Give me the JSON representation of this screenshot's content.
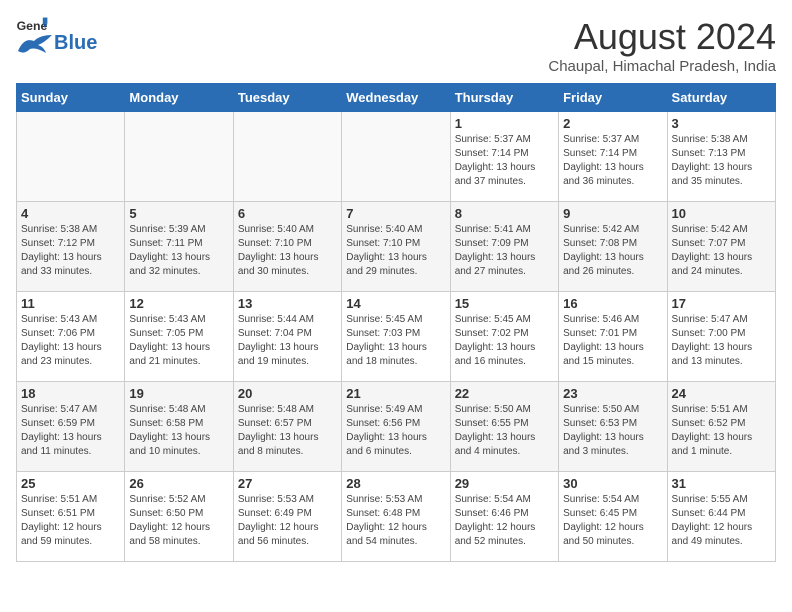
{
  "header": {
    "logo_general": "General",
    "logo_blue": "Blue",
    "title": "August 2024",
    "location": "Chaupal, Himachal Pradesh, India"
  },
  "days_of_week": [
    "Sunday",
    "Monday",
    "Tuesday",
    "Wednesday",
    "Thursday",
    "Friday",
    "Saturday"
  ],
  "weeks": [
    [
      {
        "day": "",
        "info": ""
      },
      {
        "day": "",
        "info": ""
      },
      {
        "day": "",
        "info": ""
      },
      {
        "day": "",
        "info": ""
      },
      {
        "day": "1",
        "info": "Sunrise: 5:37 AM\nSunset: 7:14 PM\nDaylight: 13 hours\nand 37 minutes."
      },
      {
        "day": "2",
        "info": "Sunrise: 5:37 AM\nSunset: 7:14 PM\nDaylight: 13 hours\nand 36 minutes."
      },
      {
        "day": "3",
        "info": "Sunrise: 5:38 AM\nSunset: 7:13 PM\nDaylight: 13 hours\nand 35 minutes."
      }
    ],
    [
      {
        "day": "4",
        "info": "Sunrise: 5:38 AM\nSunset: 7:12 PM\nDaylight: 13 hours\nand 33 minutes."
      },
      {
        "day": "5",
        "info": "Sunrise: 5:39 AM\nSunset: 7:11 PM\nDaylight: 13 hours\nand 32 minutes."
      },
      {
        "day": "6",
        "info": "Sunrise: 5:40 AM\nSunset: 7:10 PM\nDaylight: 13 hours\nand 30 minutes."
      },
      {
        "day": "7",
        "info": "Sunrise: 5:40 AM\nSunset: 7:10 PM\nDaylight: 13 hours\nand 29 minutes."
      },
      {
        "day": "8",
        "info": "Sunrise: 5:41 AM\nSunset: 7:09 PM\nDaylight: 13 hours\nand 27 minutes."
      },
      {
        "day": "9",
        "info": "Sunrise: 5:42 AM\nSunset: 7:08 PM\nDaylight: 13 hours\nand 26 minutes."
      },
      {
        "day": "10",
        "info": "Sunrise: 5:42 AM\nSunset: 7:07 PM\nDaylight: 13 hours\nand 24 minutes."
      }
    ],
    [
      {
        "day": "11",
        "info": "Sunrise: 5:43 AM\nSunset: 7:06 PM\nDaylight: 13 hours\nand 23 minutes."
      },
      {
        "day": "12",
        "info": "Sunrise: 5:43 AM\nSunset: 7:05 PM\nDaylight: 13 hours\nand 21 minutes."
      },
      {
        "day": "13",
        "info": "Sunrise: 5:44 AM\nSunset: 7:04 PM\nDaylight: 13 hours\nand 19 minutes."
      },
      {
        "day": "14",
        "info": "Sunrise: 5:45 AM\nSunset: 7:03 PM\nDaylight: 13 hours\nand 18 minutes."
      },
      {
        "day": "15",
        "info": "Sunrise: 5:45 AM\nSunset: 7:02 PM\nDaylight: 13 hours\nand 16 minutes."
      },
      {
        "day": "16",
        "info": "Sunrise: 5:46 AM\nSunset: 7:01 PM\nDaylight: 13 hours\nand 15 minutes."
      },
      {
        "day": "17",
        "info": "Sunrise: 5:47 AM\nSunset: 7:00 PM\nDaylight: 13 hours\nand 13 minutes."
      }
    ],
    [
      {
        "day": "18",
        "info": "Sunrise: 5:47 AM\nSunset: 6:59 PM\nDaylight: 13 hours\nand 11 minutes."
      },
      {
        "day": "19",
        "info": "Sunrise: 5:48 AM\nSunset: 6:58 PM\nDaylight: 13 hours\nand 10 minutes."
      },
      {
        "day": "20",
        "info": "Sunrise: 5:48 AM\nSunset: 6:57 PM\nDaylight: 13 hours\nand 8 minutes."
      },
      {
        "day": "21",
        "info": "Sunrise: 5:49 AM\nSunset: 6:56 PM\nDaylight: 13 hours\nand 6 minutes."
      },
      {
        "day": "22",
        "info": "Sunrise: 5:50 AM\nSunset: 6:55 PM\nDaylight: 13 hours\nand 4 minutes."
      },
      {
        "day": "23",
        "info": "Sunrise: 5:50 AM\nSunset: 6:53 PM\nDaylight: 13 hours\nand 3 minutes."
      },
      {
        "day": "24",
        "info": "Sunrise: 5:51 AM\nSunset: 6:52 PM\nDaylight: 13 hours\nand 1 minute."
      }
    ],
    [
      {
        "day": "25",
        "info": "Sunrise: 5:51 AM\nSunset: 6:51 PM\nDaylight: 12 hours\nand 59 minutes."
      },
      {
        "day": "26",
        "info": "Sunrise: 5:52 AM\nSunset: 6:50 PM\nDaylight: 12 hours\nand 58 minutes."
      },
      {
        "day": "27",
        "info": "Sunrise: 5:53 AM\nSunset: 6:49 PM\nDaylight: 12 hours\nand 56 minutes."
      },
      {
        "day": "28",
        "info": "Sunrise: 5:53 AM\nSunset: 6:48 PM\nDaylight: 12 hours\nand 54 minutes."
      },
      {
        "day": "29",
        "info": "Sunrise: 5:54 AM\nSunset: 6:46 PM\nDaylight: 12 hours\nand 52 minutes."
      },
      {
        "day": "30",
        "info": "Sunrise: 5:54 AM\nSunset: 6:45 PM\nDaylight: 12 hours\nand 50 minutes."
      },
      {
        "day": "31",
        "info": "Sunrise: 5:55 AM\nSunset: 6:44 PM\nDaylight: 12 hours\nand 49 minutes."
      }
    ]
  ]
}
